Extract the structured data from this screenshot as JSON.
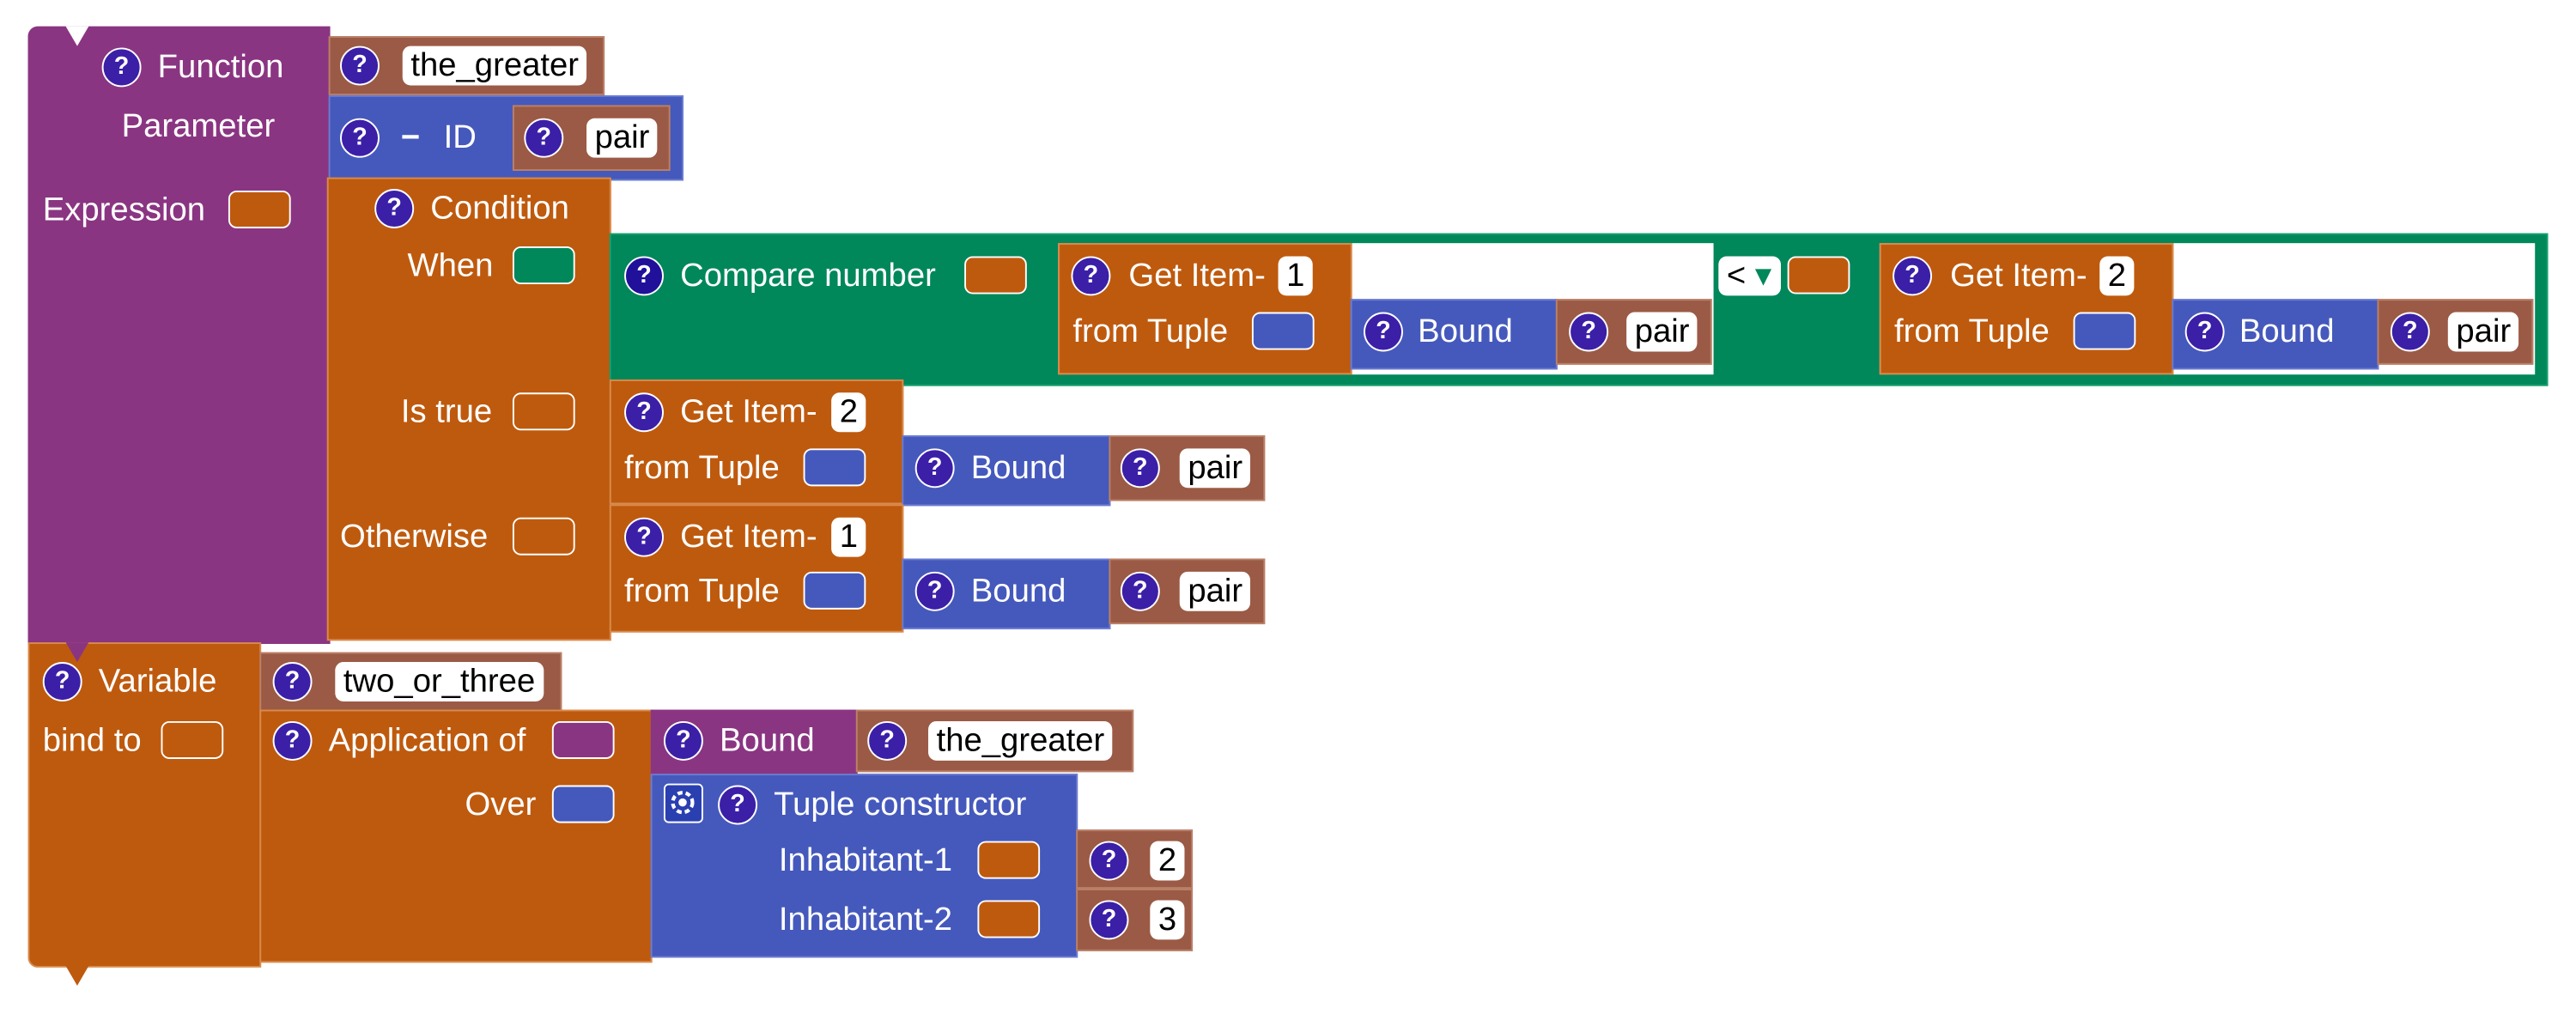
{
  "colors": {
    "function_purple": "#8A3582",
    "orange": "#BE5A0E",
    "brown": "#9B5A45",
    "blue": "#4559BC",
    "green": "#00875A",
    "help_icon": "#3b1fa7"
  },
  "function_block": {
    "help_icon": "?",
    "label": "Function",
    "name": "the_greater",
    "parameter_label": "Parameter",
    "parameter_id_label": "ID",
    "parameter_minus": "−",
    "parameter_name": "pair",
    "expression_label": "Expression"
  },
  "condition_block": {
    "label": "Condition",
    "when_label": "When",
    "is_true_label": "Is true",
    "otherwise_label": "Otherwise"
  },
  "compare_block": {
    "label": "Compare number",
    "operator": "<",
    "operator_arrow": "▾",
    "left": {
      "get_item_label": "Get Item-",
      "index": "1",
      "from_tuple_label": "from Tuple",
      "bound_label": "Bound",
      "bound_name": "pair"
    },
    "right": {
      "get_item_label": "Get Item-",
      "index": "2",
      "from_tuple_label": "from Tuple",
      "bound_label": "Bound",
      "bound_name": "pair"
    }
  },
  "is_true_block": {
    "get_item_label": "Get Item-",
    "index": "2",
    "from_tuple_label": "from Tuple",
    "bound_label": "Bound",
    "bound_name": "pair"
  },
  "otherwise_block": {
    "get_item_label": "Get Item-",
    "index": "1",
    "from_tuple_label": "from Tuple",
    "bound_label": "Bound",
    "bound_name": "pair"
  },
  "variable_block": {
    "label": "Variable",
    "name": "two_or_three",
    "bind_to_label": "bind to"
  },
  "application_block": {
    "label": "Application of",
    "bound_label": "Bound",
    "bound_name": "the_greater",
    "over_label": "Over"
  },
  "tuple_block": {
    "label": "Tuple constructor",
    "inhabitant_1_label": "Inhabitant-1",
    "inhabitant_1_value": "2",
    "inhabitant_2_label": "Inhabitant-2",
    "inhabitant_2_value": "3"
  }
}
